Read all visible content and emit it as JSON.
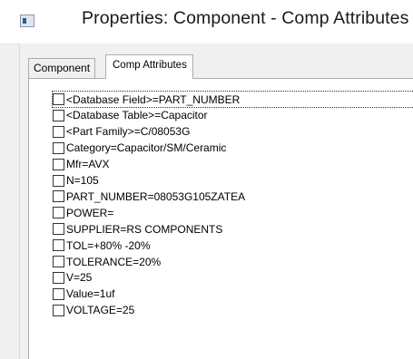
{
  "window": {
    "title": "Properties: Component - Comp Attributes",
    "app_icon": "properties-window-icon"
  },
  "tabs": [
    {
      "label": "Component",
      "selected": false
    },
    {
      "label": "Comp Attributes",
      "selected": true
    }
  ],
  "attributes": [
    {
      "label": "<Database Field>=PART_NUMBER",
      "checked": false,
      "focused": true
    },
    {
      "label": "<Database Table>=Capacitor",
      "checked": false,
      "focused": false
    },
    {
      "label": "<Part Family>=C/08053G",
      "checked": false,
      "focused": false
    },
    {
      "label": "Category=Capacitor/SM/Ceramic",
      "checked": false,
      "focused": false
    },
    {
      "label": "Mfr=AVX",
      "checked": false,
      "focused": false
    },
    {
      "label": "N=105",
      "checked": false,
      "focused": false
    },
    {
      "label": "PART_NUMBER=08053G105ZATEA",
      "checked": false,
      "focused": false
    },
    {
      "label": "POWER=",
      "checked": false,
      "focused": false
    },
    {
      "label": "SUPPLIER=RS COMPONENTS",
      "checked": false,
      "focused": false
    },
    {
      "label": "TOL=+80% -20%",
      "checked": false,
      "focused": false
    },
    {
      "label": "TOLERANCE=20%",
      "checked": false,
      "focused": false
    },
    {
      "label": "V=25",
      "checked": false,
      "focused": false
    },
    {
      "label": "Value=1uf",
      "checked": false,
      "focused": false
    },
    {
      "label": "VOLTAGE=25",
      "checked": false,
      "focused": false
    }
  ]
}
